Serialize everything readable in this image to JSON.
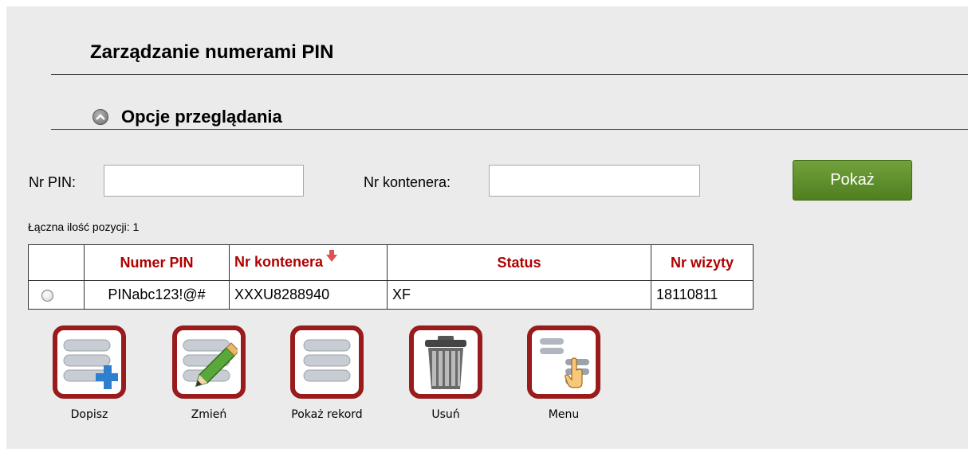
{
  "page": {
    "title": "Zarządzanie numerami PIN"
  },
  "filter": {
    "section_title": "Opcje przeglądania",
    "pin_label": "Nr PIN:",
    "pin_value": "",
    "container_label": "Nr kontenera:",
    "container_value": "",
    "show_button": "Pokaż"
  },
  "results": {
    "total_text": "Łączna ilość pozycji: 1",
    "columns": [
      "Numer PIN",
      "Nr kontenera",
      "Status",
      "Nr wizyty"
    ],
    "rows": [
      {
        "pin": "PINabc123!@#",
        "container": "XXXU8288940",
        "status": "XF",
        "visit": "18110811"
      }
    ]
  },
  "toolbar": {
    "add": "Dopisz",
    "edit": "Zmień",
    "show_record": "Pokaż rekord",
    "delete": "Usuń",
    "menu": "Menu"
  },
  "colors": {
    "header_text": "#b00000",
    "link": "#8b1a1a",
    "button_green": "#5a8c2a",
    "frame_red": "#991b1b",
    "panel_bg": "#ebebeb"
  },
  "icons": {
    "collapse": "chevron-up-circle-icon",
    "sort": "sort-down-arrow-icon",
    "add": "list-add-icon",
    "edit": "list-edit-pencil-icon",
    "show_record": "list-icon",
    "delete": "trash-icon",
    "menu": "menu-hand-icon"
  }
}
